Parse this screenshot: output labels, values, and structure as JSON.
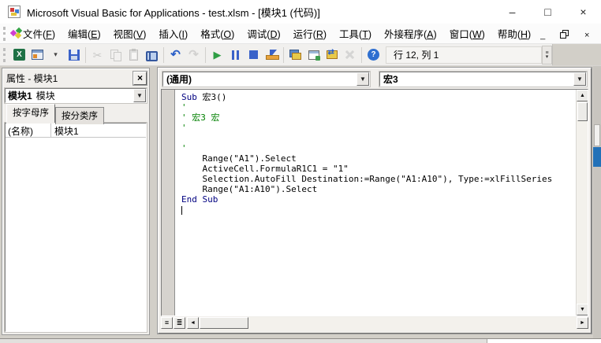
{
  "window": {
    "title": "Microsoft Visual Basic for Applications - test.xlsm - [模块1 (代码)]",
    "controls": [
      {
        "name": "minimize-button",
        "glyph": "–"
      },
      {
        "name": "maximize-button",
        "glyph": "□"
      },
      {
        "name": "close-button",
        "glyph": "×"
      }
    ]
  },
  "menubar": {
    "items": [
      "文件(F)",
      "编辑(E)",
      "视图(V)",
      "插入(I)",
      "格式(O)",
      "调试(D)",
      "运行(R)",
      "工具(T)",
      "外接程序(A)",
      "窗口(W)",
      "帮助(H)"
    ],
    "mdi_controls": [
      {
        "name": "mdi-minimize-button",
        "glyph": "_"
      },
      {
        "name": "mdi-restore-button",
        "glyph": ""
      },
      {
        "name": "mdi-close-button",
        "glyph": "×"
      }
    ]
  },
  "toolbar": {
    "position_label": "行 12, 列 1",
    "overflow_glyphs": [
      "≡",
      "▾"
    ],
    "items": [
      {
        "name": "view-excel-button",
        "icon": "view-excel-icon",
        "glyph": "X"
      },
      {
        "name": "insert-userform-button",
        "icon": "insert-userform-icon",
        "glyph": ""
      },
      {
        "name": "insert-dropdown-button",
        "icon": "chevron-down-icon",
        "glyph": "▾"
      },
      {
        "name": "save-button",
        "icon": "save-icon",
        "glyph": ""
      },
      {
        "type": "separator"
      },
      {
        "name": "cut-button",
        "icon": "cut-icon",
        "glyph": "✂",
        "disabled": true
      },
      {
        "name": "copy-button",
        "icon": "copy-icon",
        "glyph": "",
        "disabled": true
      },
      {
        "name": "paste-button",
        "icon": "paste-icon",
        "glyph": "",
        "disabled": true
      },
      {
        "name": "find-button",
        "icon": "find-icon",
        "glyph": ""
      },
      {
        "type": "separator"
      },
      {
        "name": "undo-button",
        "icon": "undo-icon",
        "glyph": "↶"
      },
      {
        "name": "redo-button",
        "icon": "redo-icon",
        "glyph": "↷",
        "disabled": true
      },
      {
        "type": "separator"
      },
      {
        "name": "run-button",
        "icon": "run-icon",
        "glyph": "▶"
      },
      {
        "name": "break-button",
        "icon": "break-icon",
        "glyph": ""
      },
      {
        "name": "reset-button",
        "icon": "reset-icon",
        "glyph": ""
      },
      {
        "name": "design-mode-button",
        "icon": "design-mode-icon",
        "glyph": ""
      },
      {
        "type": "separator"
      },
      {
        "name": "project-explorer-button",
        "icon": "project-explorer-icon",
        "glyph": ""
      },
      {
        "name": "properties-window-button",
        "icon": "properties-window-icon",
        "glyph": ""
      },
      {
        "name": "object-browser-button",
        "icon": "object-browser-icon",
        "glyph": ""
      },
      {
        "name": "toolbox-button",
        "icon": "toolbox-icon",
        "glyph": "",
        "disabled": true
      },
      {
        "type": "separator"
      },
      {
        "name": "help-button",
        "icon": "help-icon",
        "glyph": "?"
      }
    ]
  },
  "properties_panel": {
    "title": "属性 - 模块1",
    "close_glyph": "×",
    "selected_object": "模块1",
    "selected_object_type": "模块",
    "dropdown_glyph": "▼",
    "tabs": [
      {
        "label": "按字母序",
        "active": true
      },
      {
        "label": "按分类序",
        "active": false
      }
    ],
    "rows": [
      {
        "name": "(名称)",
        "value": "模块1"
      }
    ]
  },
  "code_window": {
    "object_dropdown": "(通用)",
    "procedure_dropdown": "宏3",
    "dropdown_glyph": "▼",
    "colors": {
      "keyword": "#000080",
      "comment": "#008000",
      "text": "#000000"
    },
    "lines": [
      [
        {
          "t": "Sub",
          "c": "keyword"
        },
        {
          "t": " 宏3()",
          "c": "text"
        }
      ],
      [
        {
          "t": "'",
          "c": "comment"
        }
      ],
      [
        {
          "t": "' 宏3 宏",
          "c": "comment"
        }
      ],
      [
        {
          "t": "'",
          "c": "comment"
        }
      ],
      [],
      [
        {
          "t": "'",
          "c": "comment"
        }
      ],
      [
        {
          "t": "    Range(\"A1\").Select",
          "c": "text"
        }
      ],
      [
        {
          "t": "    ActiveCell.FormulaR1C1 = \"1\"",
          "c": "text"
        }
      ],
      [
        {
          "t": "    Selection.AutoFill Destination:=Range(\"A1:A10\"), Type:=xlFillSeries",
          "c": "text"
        }
      ],
      [
        {
          "t": "    Range(\"A1:A10\").Select",
          "c": "text"
        }
      ],
      [
        {
          "t": "End Sub",
          "c": "keyword"
        }
      ],
      []
    ],
    "view_buttons": [
      {
        "name": "procedure-view-button",
        "glyph": "≡"
      },
      {
        "name": "full-module-view-button",
        "glyph": "≣"
      }
    ],
    "scroll_glyphs": {
      "up": "▲",
      "down": "▼",
      "left": "◄",
      "right": "►"
    }
  },
  "background": {
    "accent_block_color": "#2271b8"
  }
}
